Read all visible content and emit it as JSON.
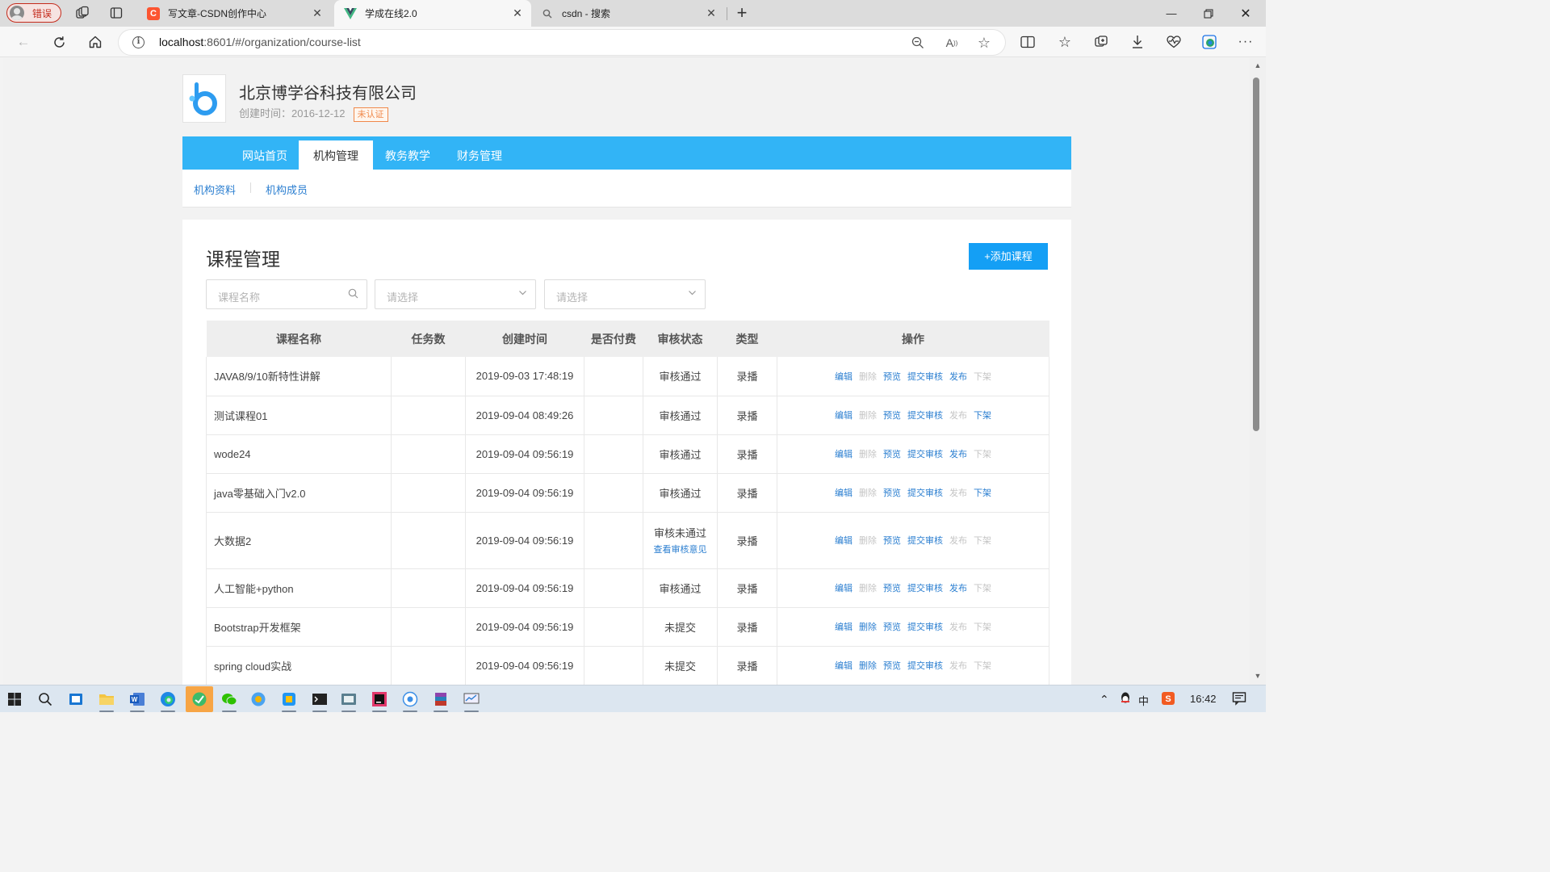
{
  "browser": {
    "profile_label": "错误",
    "tabs": [
      {
        "title": "写文章-CSDN创作中心",
        "favicon": "csdn-icon",
        "color": "#fc5531"
      },
      {
        "title": "学成在线2.0",
        "favicon": "vue-icon",
        "color": "#41b883"
      },
      {
        "title": "csdn - 搜索",
        "favicon": "search-icon",
        "color": "#666666"
      }
    ],
    "url_host": "localhost",
    "url_rest": ":8601/#/organization/course-list"
  },
  "org": {
    "name": "北京博学谷科技有限公司",
    "created_label": "创建时间：2016-12-12",
    "badge": "未认证"
  },
  "menu": {
    "items": [
      "网站首页",
      "机构管理",
      "教务教学",
      "财务管理"
    ],
    "active": "机构管理"
  },
  "submenu": {
    "items": [
      "机构资料",
      "机构成员"
    ]
  },
  "page": {
    "title": "课程管理",
    "add_button": "+添加课程"
  },
  "filters": {
    "name_placeholder": "课程名称",
    "select1_placeholder": "请选择",
    "select2_placeholder": "请选择"
  },
  "table": {
    "columns": [
      "课程名称",
      "任务数",
      "创建时间",
      "是否付费",
      "审核状态",
      "类型",
      "操作"
    ],
    "action_labels": [
      "编辑",
      "删除",
      "预览",
      "提交审核",
      "发布",
      "下架"
    ],
    "status_link": "查看审核意见",
    "rows": [
      {
        "name": "JAVA8/9/10新特性讲解",
        "tasks": "",
        "created": "2019-09-03 17:48:19",
        "paid": "",
        "status": "审核通过",
        "type": "录播"
      },
      {
        "name": "测试课程01",
        "tasks": "",
        "created": "2019-09-04 08:49:26",
        "paid": "",
        "status": "审核通过",
        "type": "录播"
      },
      {
        "name": "wode24",
        "tasks": "",
        "created": "2019-09-04 09:56:19",
        "paid": "",
        "status": "审核通过",
        "type": "录播"
      },
      {
        "name": "java零基础入门v2.0",
        "tasks": "",
        "created": "2019-09-04 09:56:19",
        "paid": "",
        "status": "审核通过",
        "type": "录播"
      },
      {
        "name": "大数据2",
        "tasks": "",
        "created": "2019-09-04 09:56:19",
        "paid": "",
        "status": "审核未通过",
        "type": "录播"
      },
      {
        "name": "人工智能+python",
        "tasks": "",
        "created": "2019-09-04 09:56:19",
        "paid": "",
        "status": "审核通过",
        "type": "录播"
      },
      {
        "name": "Bootstrap开发框架",
        "tasks": "",
        "created": "2019-09-04 09:56:19",
        "paid": "",
        "status": "未提交",
        "type": "录播"
      },
      {
        "name": "spring cloud实战",
        "tasks": "",
        "created": "2019-09-04 09:56:19",
        "paid": "",
        "status": "未提交",
        "type": "录播"
      }
    ]
  },
  "taskbar": {
    "clock": "16:42",
    "ime": "中"
  }
}
